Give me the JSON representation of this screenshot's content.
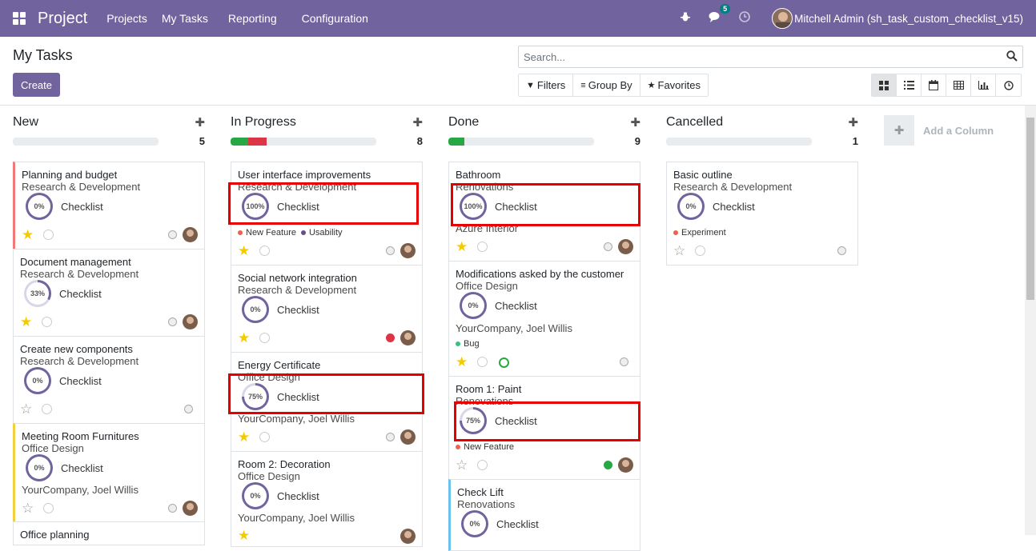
{
  "nav": {
    "brand": "Project",
    "menu": [
      "Projects",
      "My Tasks",
      "Reporting",
      "Configuration"
    ],
    "messages_badge": "5",
    "user": "Mitchell Admin (sh_task_custom_checklist_v15)"
  },
  "page_title": "My Tasks",
  "create_label": "Create",
  "search_placeholder": "Search...",
  "filters": {
    "filters": "Filters",
    "group_by": "Group By",
    "favorites": "Favorites"
  },
  "add_column": "Add a Column",
  "checklist_label": "Checklist",
  "columns": [
    {
      "title": "New",
      "count": "5",
      "progress": []
    },
    {
      "title": "In Progress",
      "count": "8",
      "progress": [
        {
          "color": "#28a745",
          "pct": 12
        },
        {
          "color": "#dc3545",
          "pct": 13
        }
      ]
    },
    {
      "title": "Done",
      "count": "9",
      "progress": [
        {
          "color": "#28a745",
          "pct": 11
        }
      ]
    },
    {
      "title": "Cancelled",
      "count": "1",
      "progress": []
    }
  ],
  "cards": {
    "new_0": {
      "title": "Planning and budget",
      "project": "Research & Development",
      "pct": "0%"
    },
    "new_1": {
      "title": "Document management",
      "project": "Research & Development",
      "pct": "33%"
    },
    "new_2": {
      "title": "Create new components",
      "project": "Research & Development",
      "pct": "0%"
    },
    "new_3": {
      "title": "Meeting Room Furnitures",
      "project": "Office Design",
      "pct": "0%",
      "customer": "YourCompany, Joel Willis"
    },
    "new_4": {
      "title": "Office planning"
    },
    "ip_0": {
      "title": "User interface improvements",
      "project": "Research & Development",
      "pct": "100%",
      "tags": [
        "New Feature",
        "Usability"
      ]
    },
    "ip_1": {
      "title": "Social network integration",
      "project": "Research & Development",
      "pct": "0%"
    },
    "ip_2": {
      "title": "Energy Certificate",
      "project": "Office Design",
      "pct": "75%",
      "customer": "YourCompany, Joel Willis"
    },
    "ip_3": {
      "title": "Room 2: Decoration",
      "project": "Office Design",
      "pct": "0%",
      "customer": "YourCompany, Joel Willis"
    },
    "done_0": {
      "title": "Bathroom",
      "project": "Renovations",
      "pct": "100%",
      "customer": "Azure Interior"
    },
    "done_1": {
      "title": "Modifications asked by the customer",
      "project": "Office Design",
      "pct": "0%",
      "customer": "YourCompany, Joel Willis",
      "tags": [
        "Bug"
      ]
    },
    "done_2": {
      "title": "Room 1: Paint",
      "project": "Renovations",
      "pct": "75%",
      "tags": [
        "New Feature"
      ]
    },
    "done_3": {
      "title": "Check Lift",
      "project": "Renovations",
      "pct": "0%"
    },
    "cancel_0": {
      "title": "Basic outline",
      "project": "Research & Development",
      "pct": "0%",
      "tags": [
        "Experiment"
      ]
    }
  }
}
